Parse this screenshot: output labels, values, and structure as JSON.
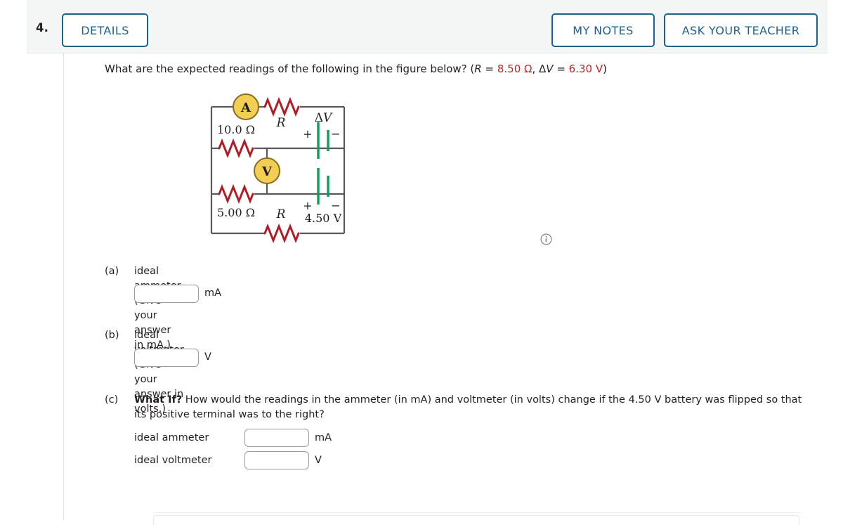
{
  "question": {
    "number": "4.",
    "prompt_pre": "What are the expected readings of the following in the figure below? (",
    "prompt_R_symbol": "R",
    "prompt_eq1": " = ",
    "prompt_R_value": "8.50 Ω",
    "prompt_comma": ", ",
    "prompt_dV_symbol": "ΔV",
    "prompt_eq2": " = ",
    "prompt_dV_value": "6.30 V",
    "prompt_post": ")"
  },
  "toolbar": {
    "details_label": "DETAILS",
    "my_notes_label": "MY NOTES",
    "ask_teacher_label": "ASK YOUR TEACHER"
  },
  "figure": {
    "ammeter_label": "A",
    "voltmeter_label": "V",
    "resistor_top_label": "R",
    "resistor_bottom_label": "R",
    "resistor_10_label": "10.0 Ω",
    "resistor_5_label": "5.00 Ω",
    "battery_top_label": "ΔV",
    "battery_top_plus": "+",
    "battery_top_minus": "−",
    "battery_bottom_label": "4.50 V",
    "battery_bottom_plus": "+",
    "battery_bottom_minus": "−",
    "info_icon_label": "i"
  },
  "parts": {
    "a": {
      "label": "(a)",
      "text": "ideal ammeter (Give your answer in mA.)",
      "value": "",
      "placeholder": "",
      "unit": "mA"
    },
    "b": {
      "label": "(b)",
      "text": "ideal voltmeter (Give your answer in volts.)",
      "value": "",
      "placeholder": "",
      "unit": "V"
    },
    "c": {
      "label": "(c)",
      "whatif": "What If?",
      "text_line1": " How would the readings in the ammeter (in mA) and voltmeter (in volts) change if the 4.50 V battery was flipped",
      "text_line2": "so that its positive terminal was to the right?",
      "rows": [
        {
          "label": "ideal ammeter",
          "value": "",
          "placeholder": "",
          "unit": "mA"
        },
        {
          "label": "ideal voltmeter",
          "value": "",
          "placeholder": "",
          "unit": "V"
        }
      ]
    }
  },
  "colors": {
    "accent": "#1d6389",
    "value_red": "#cc2026",
    "resistor_red": "#b01b25",
    "meter_fill": "#f2cf52",
    "meter_stroke": "#8a6d1f",
    "battery_green": "#0f9d58",
    "wire": "#58595b",
    "header_bg": "#f4f5f5"
  }
}
